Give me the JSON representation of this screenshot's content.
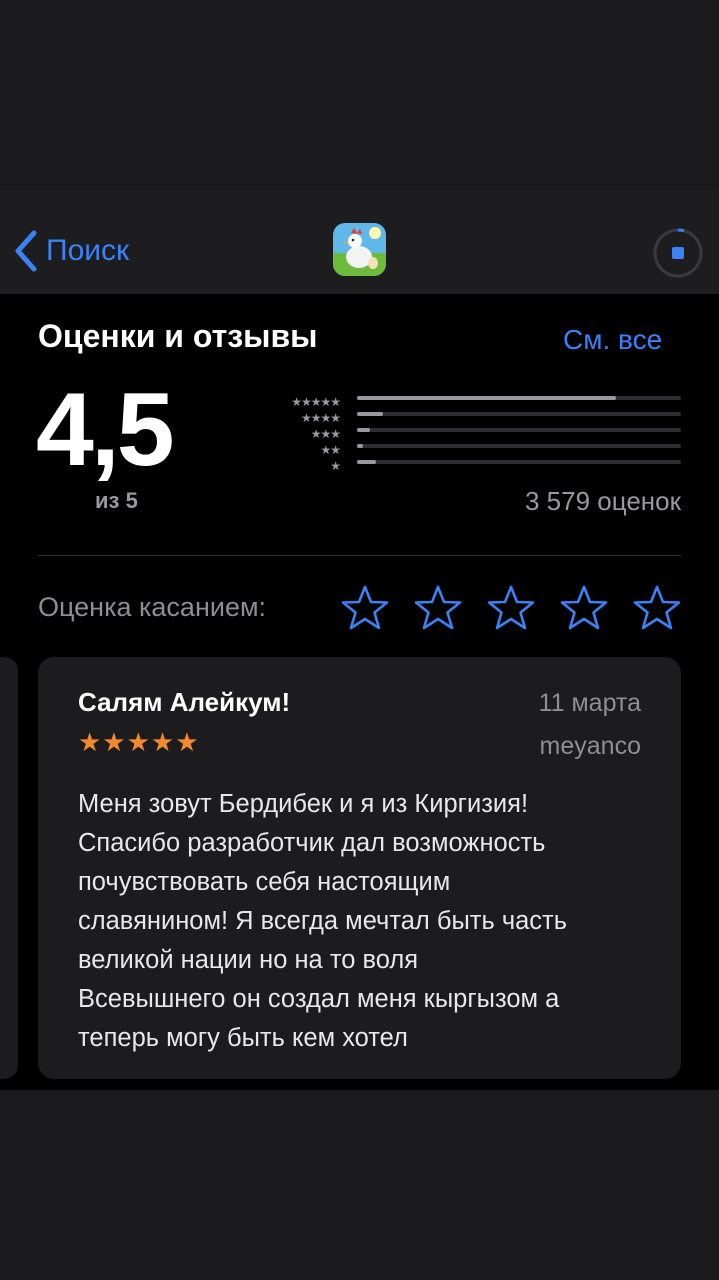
{
  "nav": {
    "back_label": "Поиск",
    "app_icon": "chicken-app-icon",
    "stop_icon": "stop-download-icon"
  },
  "ratings": {
    "title": "Оценки и отзывы",
    "see_all": "См. все",
    "average": "4,5",
    "out_of": "из 5",
    "count_label": "3 579 оценок",
    "distribution": [
      {
        "stars": "★★★★★",
        "fraction": 0.8
      },
      {
        "stars": "★★★★",
        "fraction": 0.08
      },
      {
        "stars": "★★★",
        "fraction": 0.04
      },
      {
        "stars": "★★",
        "fraction": 0.02
      },
      {
        "stars": "★",
        "fraction": 0.06
      }
    ]
  },
  "tap_to_rate": {
    "label": "Оценка касанием:",
    "star_count": 5
  },
  "review": {
    "title": "Салям Алейкум!",
    "date": "11 марта",
    "stars": "★★★★★",
    "author": "meyanco",
    "body_lines": [
      "Меня зовут Бердибек и я из Киргизия!",
      "Спасибо разработчик дал возможность",
      "почувствовать себя настоящим",
      "славянином! Я всегда мечтал быть часть",
      "великой нации но на то воля",
      "Всевышнего он создал меня кыргызом а",
      "теперь могу быть кем хотел"
    ]
  },
  "colors": {
    "accent": "#3a82f6",
    "star_orange": "#f08a2c",
    "background": "#000000",
    "card": "#1c1c1e"
  }
}
